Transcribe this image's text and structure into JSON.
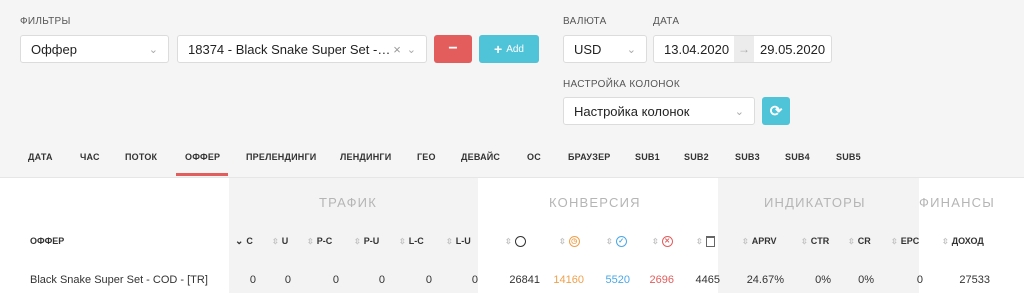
{
  "filters": {
    "label": "ФИЛЬТРЫ",
    "type_select": "Оффер",
    "offer_select": "18374 - Black Snake Super Set - COD...",
    "clear_icon": "×",
    "remove_label": "−",
    "add_label": "Add"
  },
  "currency": {
    "label": "ВАЛЮТА",
    "value": "USD"
  },
  "date": {
    "label": "ДАТА",
    "from": "13.04.2020",
    "to": "29.05.2020"
  },
  "columns": {
    "label": "НАСТРОЙКА КОЛОНОК",
    "value": "Настройка колонок"
  },
  "tabs": [
    "ДАТА",
    "ЧАС",
    "ПОТОК",
    "ОФФЕР",
    "ПРЕЛЕНДИНГИ",
    "ЛЕНДИНГИ",
    "ГЕО",
    "ДЕВАЙС",
    "ОС",
    "БРАУЗЕР",
    "SUB1",
    "SUB2",
    "SUB3",
    "SUB4",
    "SUB5"
  ],
  "active_tab": "ОФФЕР",
  "groups": {
    "traffic": "ТРАФИК",
    "conversion": "КОНВЕРСИЯ",
    "indicators": "ИНДИКАТОРЫ",
    "finance": "ФИНАНСЫ"
  },
  "headers": {
    "offer": "ОФФЕР",
    "c": "C",
    "u": "U",
    "pc": "P-C",
    "pu": "P-U",
    "lc": "L-C",
    "lu": "L-U",
    "aprv": "APRV",
    "ctr": "CTR",
    "cr": "CR",
    "epc": "EPC",
    "income": "ДОХОД"
  },
  "row": {
    "offer": "Black Snake Super Set - COD - [TR]",
    "c": "0",
    "u": "0",
    "pc": "0",
    "pu": "0",
    "lc": "0",
    "lu": "0",
    "total": "26841",
    "hold": "14160",
    "approved": "5520",
    "rejected": "2696",
    "trash": "4465",
    "aprv": "24.67%",
    "ctr": "0%",
    "cr": "0%",
    "epc": "0",
    "income": "27533"
  },
  "colors": {
    "red": "#e35d5d",
    "teal": "#4fc3d8",
    "orange": "#f0a04b",
    "blue": "#4aa8e8",
    "active_tab": "#e35d5d"
  }
}
